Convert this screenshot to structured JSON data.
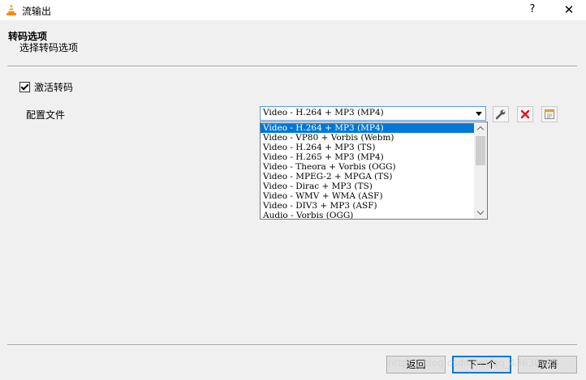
{
  "window": {
    "title": "流输出",
    "help_label": "?",
    "close_label": "✕",
    "icon": "vlc-cone-icon"
  },
  "header": {
    "title": "转码选项",
    "subtitle": "选择转码选项"
  },
  "transcode": {
    "activate_label": "激活转码",
    "activate_checked": true,
    "profile_label": "配置文件",
    "selected": "Video - H.264 + MP3 (MP4)",
    "options": [
      "Video - H.264 + MP3 (MP4)",
      "Video - VP80 + Vorbis (Webm)",
      "Video - H.264 + MP3 (TS)",
      "Video - H.265 + MP3 (MP4)",
      "Video - Theora + Vorbis (OGG)",
      "Video - MPEG-2 + MPGA (TS)",
      "Video - Dirac + MP3 (TS)",
      "Video - WMV + WMA (ASF)",
      "Video - DIV3 + MP3 (ASF)",
      "Audio - Vorbis (OGG)"
    ],
    "tools": {
      "edit_icon": "wrench-icon",
      "delete_icon": "red-x-icon",
      "new_icon": "new-profile-icon"
    }
  },
  "footer": {
    "back_label": "返回",
    "next_label": "下一个",
    "cancel_label": "取消"
  },
  "watermark": "https://blog.csdn.net/qq_43630528",
  "colors": {
    "selection": "#0078d7",
    "delete_red": "#e81123",
    "vlc_orange": "#ff8800"
  }
}
